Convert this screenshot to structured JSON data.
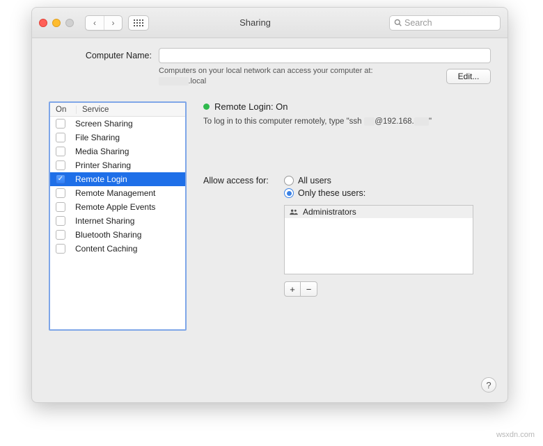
{
  "window": {
    "title": "Sharing"
  },
  "toolbar": {
    "search_placeholder": "Search"
  },
  "computer_name": {
    "label": "Computer Name:",
    "hint1": "Computers on your local network can access your computer at:",
    "hint2_suffix": ".local",
    "edit_label": "Edit..."
  },
  "services": {
    "head_on": "On",
    "head_service": "Service",
    "items": [
      {
        "label": "Screen Sharing"
      },
      {
        "label": "File Sharing"
      },
      {
        "label": "Media Sharing"
      },
      {
        "label": "Printer Sharing"
      },
      {
        "label": "Remote Login"
      },
      {
        "label": "Remote Management"
      },
      {
        "label": "Remote Apple Events"
      },
      {
        "label": "Internet Sharing"
      },
      {
        "label": "Bluetooth Sharing"
      },
      {
        "label": "Content Caching"
      }
    ]
  },
  "detail": {
    "status": "Remote Login: On",
    "login_prefix": "To log in to this computer remotely, type \"ssh ",
    "login_at": "@192.168.",
    "login_end": "\"",
    "access_label": "Allow access for:",
    "radio_all": "All users",
    "radio_only": "Only these users:",
    "user_group": "Administrators"
  },
  "help": {
    "label": "?"
  },
  "watermark": "wsxdn.com"
}
